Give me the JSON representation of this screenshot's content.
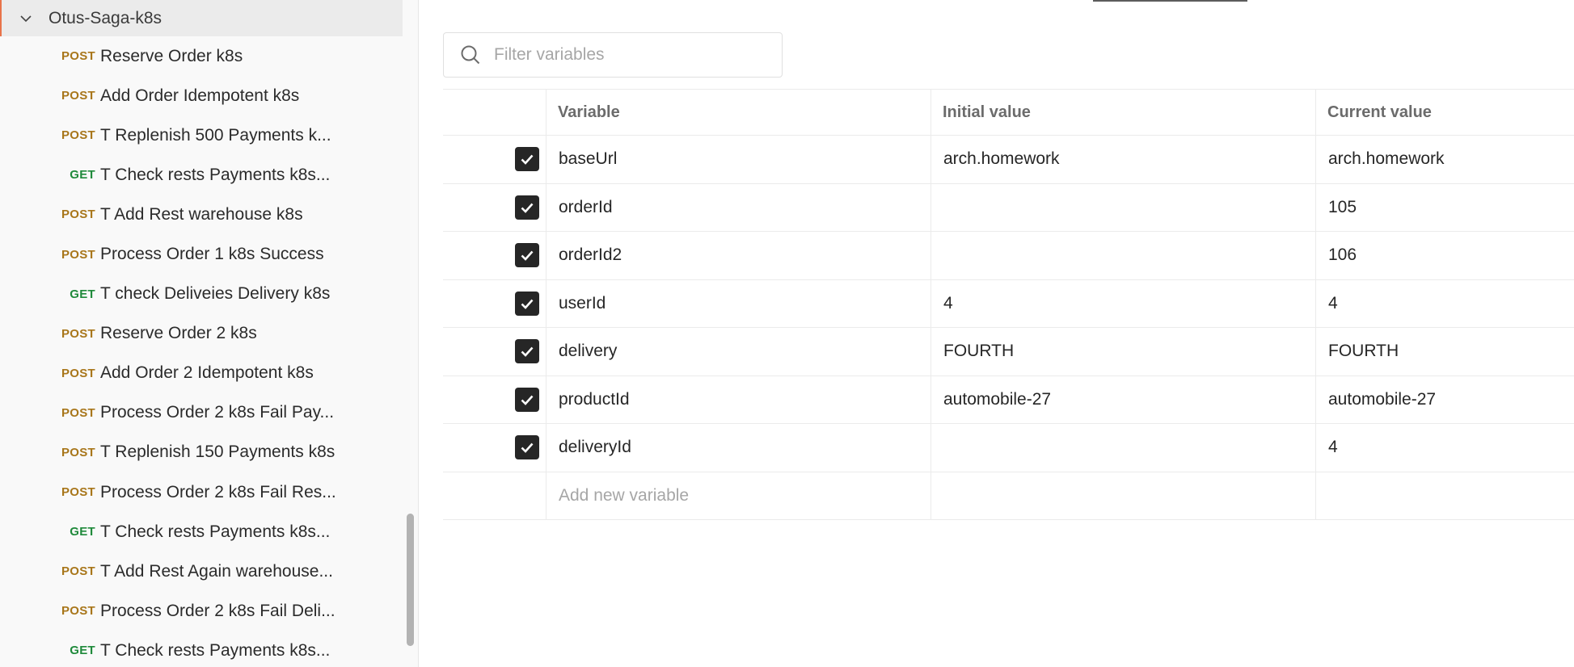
{
  "sidebar": {
    "collection_name": "Otus-Saga-k8s",
    "requests": [
      {
        "method": "POST",
        "name": "Reserve Order k8s"
      },
      {
        "method": "POST",
        "name": "Add Order Idempotent k8s"
      },
      {
        "method": "POST",
        "name": "T Replenish 500 Payments k..."
      },
      {
        "method": "GET",
        "name": "T Check rests Payments k8s..."
      },
      {
        "method": "POST",
        "name": "T Add Rest warehouse k8s"
      },
      {
        "method": "POST",
        "name": "Process Order 1 k8s Success"
      },
      {
        "method": "GET",
        "name": "T check Deliveies Delivery k8s"
      },
      {
        "method": "POST",
        "name": "Reserve Order 2 k8s"
      },
      {
        "method": "POST",
        "name": "Add Order 2 Idempotent k8s"
      },
      {
        "method": "POST",
        "name": "Process Order 2 k8s Fail Pay..."
      },
      {
        "method": "POST",
        "name": "T Replenish 150 Payments k8s"
      },
      {
        "method": "POST",
        "name": "Process Order 2 k8s Fail Res..."
      },
      {
        "method": "GET",
        "name": "T Check rests Payments k8s..."
      },
      {
        "method": "POST",
        "name": "T Add Rest Again warehouse..."
      },
      {
        "method": "POST",
        "name": "Process Order 2 k8s Fail Deli..."
      },
      {
        "method": "GET",
        "name": "T Check rests Payments k8s..."
      }
    ]
  },
  "filter": {
    "placeholder": "Filter variables"
  },
  "table": {
    "headers": {
      "variable": "Variable",
      "initial": "Initial value",
      "current": "Current value"
    },
    "rows": [
      {
        "enabled": true,
        "variable": "baseUrl",
        "initial": "arch.homework",
        "current": "arch.homework"
      },
      {
        "enabled": true,
        "variable": "orderId",
        "initial": "",
        "current": "105"
      },
      {
        "enabled": true,
        "variable": "orderId2",
        "initial": "",
        "current": "106"
      },
      {
        "enabled": true,
        "variable": "userId",
        "initial": "4",
        "current": "4"
      },
      {
        "enabled": true,
        "variable": "delivery",
        "initial": "FOURTH",
        "current": "FOURTH"
      },
      {
        "enabled": true,
        "variable": "productId",
        "initial": "automobile-27",
        "current": "automobile-27"
      },
      {
        "enabled": true,
        "variable": "deliveryId",
        "initial": "",
        "current": "4"
      }
    ],
    "add_placeholder": "Add new variable"
  },
  "colors": {
    "post": "#a8761a",
    "get": "#1f8a3b",
    "accent": "#e8734a"
  }
}
